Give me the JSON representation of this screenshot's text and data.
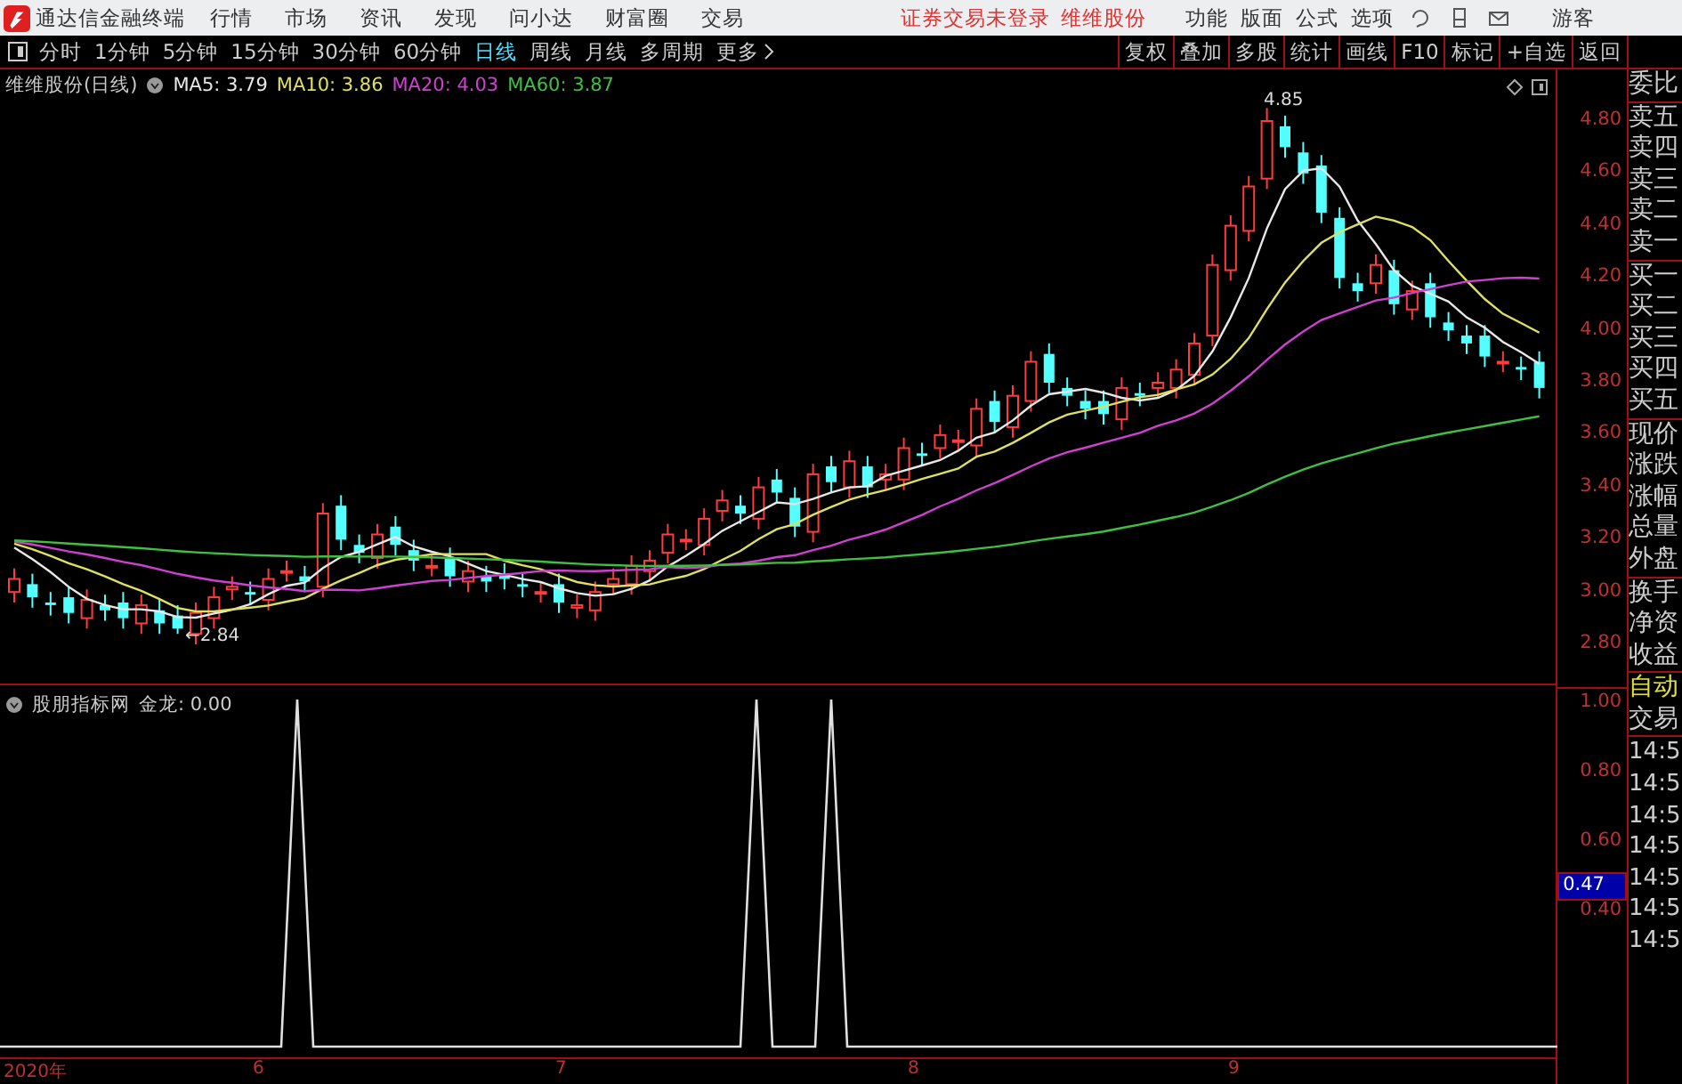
{
  "app_title": "通达信金融终端",
  "menu": [
    "行情",
    "市场",
    "资讯",
    "发现",
    "问小达",
    "财富圈",
    "交易"
  ],
  "login_status": "证券交易未登录",
  "stock_link": "维维股份",
  "tools_menu": [
    "功能",
    "版面",
    "公式",
    "选项"
  ],
  "user": "游客",
  "periods": [
    {
      "label": "分时",
      "selected": false
    },
    {
      "label": "1分钟",
      "selected": false
    },
    {
      "label": "5分钟",
      "selected": false
    },
    {
      "label": "15分钟",
      "selected": false
    },
    {
      "label": "30分钟",
      "selected": false
    },
    {
      "label": "60分钟",
      "selected": false
    },
    {
      "label": "日线",
      "selected": true
    },
    {
      "label": "周线",
      "selected": false
    },
    {
      "label": "月线",
      "selected": false
    },
    {
      "label": "多周期",
      "selected": false
    }
  ],
  "more": "更多",
  "actions": [
    "复权",
    "叠加",
    "多股",
    "统计",
    "画线",
    "F10",
    "标记",
    "+自选",
    "返回"
  ],
  "chart_title": "维维股份(日线)",
  "ma_legend": [
    {
      "label": "MA5: 3.79",
      "color": "#e8e8e8"
    },
    {
      "label": "MA10: 3.86",
      "color": "#e0e060"
    },
    {
      "label": "MA20: 4.03",
      "color": "#d040d0"
    },
    {
      "label": "MA60: 3.87",
      "color": "#40c040"
    }
  ],
  "high_marker": "4.85",
  "low_marker": "←2.84",
  "price_labels": [
    "4.80",
    "4.60",
    "4.40",
    "4.20",
    "4.00",
    "3.80",
    "3.60",
    "3.40",
    "3.20",
    "3.00",
    "2.80"
  ],
  "quote_groups": [
    [
      "委比"
    ],
    [
      "卖五",
      "卖四",
      "卖三",
      "卖二",
      "卖一"
    ],
    [
      "买一",
      "买二",
      "买三",
      "买四",
      "买五"
    ],
    [
      "现价",
      "涨跌",
      "涨幅",
      "总量",
      "外盘"
    ],
    [
      "换手",
      "净资",
      "收益"
    ]
  ],
  "indicator": {
    "title": "股朋指标网",
    "value": "金龙: 0.00",
    "axis_labels": [
      "1.00",
      "0.80",
      "0.60",
      "0.40"
    ],
    "current_value": "0.47"
  },
  "trade": {
    "mode": "自动",
    "heading": "交易",
    "times": [
      "14:5",
      "14:5",
      "14:5",
      "14:5",
      "14:5",
      "14:5",
      "14:5"
    ]
  },
  "date_axis": [
    "2020年",
    "6",
    "7",
    "8",
    "9"
  ]
}
